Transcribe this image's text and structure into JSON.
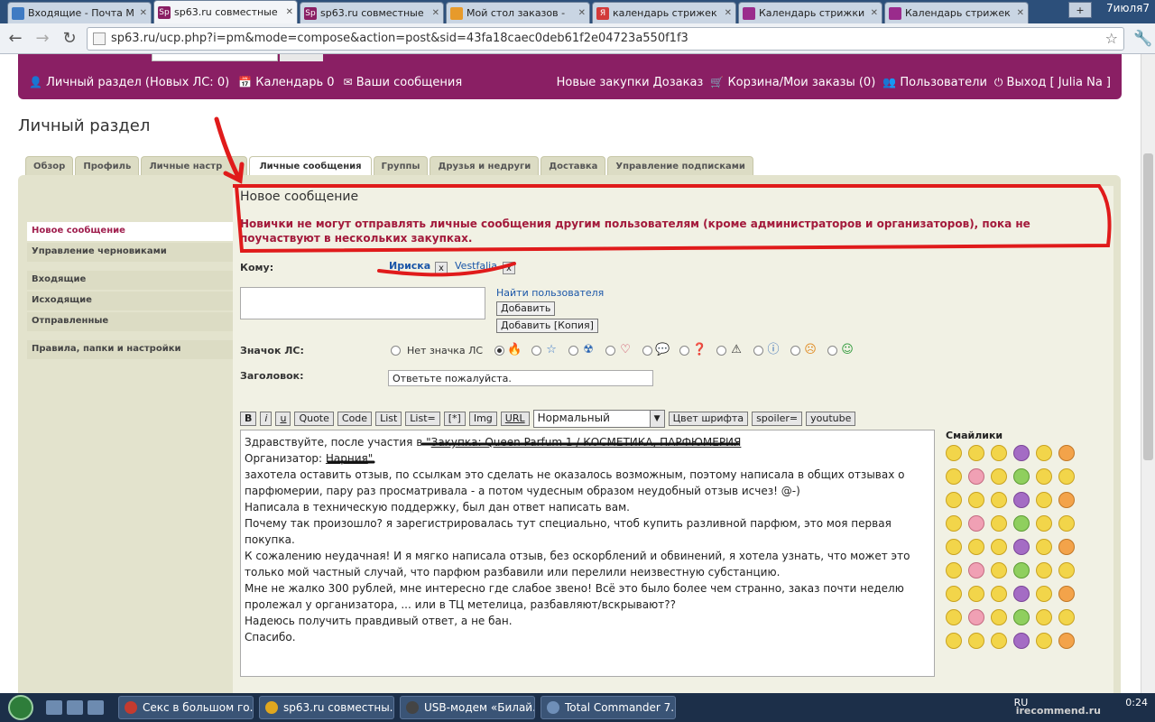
{
  "browser": {
    "tabs": [
      {
        "title": "Входящие - Почта M",
        "color": "#3f7bc3"
      },
      {
        "title": "sp63.ru совместные",
        "color": "#8a1f64"
      },
      {
        "title": "sp63.ru совместные",
        "color": "#8a1f64"
      },
      {
        "title": "Мой стол заказов - ",
        "color": "#e79a2b"
      },
      {
        "title": "календарь стрижек",
        "color": "#d23a3a"
      },
      {
        "title": "Календарь стрижки",
        "color": "#9a2b8c"
      },
      {
        "title": "Календарь стрижек",
        "color": "#9a2b8c"
      }
    ],
    "date_corner": "7июля7",
    "url": "sp63.ru/ucp.php?i=pm&mode=compose&action=post&sid=43fa18caec0deb61f2e04723a550f1f3"
  },
  "topbar": {
    "left": [
      {
        "icon": "person-icon",
        "label": "Личный раздел (Новых ЛС: 0)"
      },
      {
        "icon": "calendar-icon",
        "label": "Календарь 0"
      },
      {
        "icon": "envelope-icon",
        "label": "Ваши сообщения"
      }
    ],
    "right": [
      {
        "label": "Новые закупки"
      },
      {
        "label": "Дозаказ"
      },
      {
        "icon": "cart-icon",
        "label": "Корзина/Мои заказы (0)"
      },
      {
        "icon": "users-icon",
        "label": "Пользователи"
      },
      {
        "icon": "power-icon",
        "label": "Выход [ Julia Na ]"
      }
    ]
  },
  "page_title": "Личный раздел",
  "tabs": [
    "Обзор",
    "Профиль",
    "Личные настр",
    "Личные сообщения",
    "Группы",
    "Друзья и недруги",
    "Доставка",
    "Управление подписками"
  ],
  "sidenav": {
    "group1": [
      "Новое сообщение",
      "Управление черновиками"
    ],
    "group2": [
      "Входящие",
      "Исходящие",
      "Отправленные"
    ],
    "group3": [
      "Правила, папки и настройки"
    ]
  },
  "compose": {
    "heading": "Новое сообщение",
    "warning": "Новички не могут отправлять личные сообщения другим пользователям (кроме администраторов и организаторов), пока не поучаствуют в нескольких закупках.",
    "to_label": "Кому:",
    "recipients": [
      "Ириска",
      "Vestfalia"
    ],
    "remove_glyph": "x",
    "find_user": "Найти пользователя",
    "add_button": "Добавить",
    "add_copy_button": "Добавить [Копия]",
    "icon_label": "Значок ЛС:",
    "no_icon_label": "Нет значка ЛС",
    "icons": [
      "fire-icon",
      "star-icon",
      "radiation-icon",
      "heart-icon",
      "speech-bubble-icon",
      "question-icon",
      "warning-icon",
      "info-icon",
      "sad-face-icon",
      "grin-face-icon"
    ],
    "subject_label": "Заголовок:",
    "subject_value": "Ответьте пожалуйста.",
    "format_buttons": [
      "B",
      "i",
      "u",
      "Quote",
      "Code",
      "List",
      "List=",
      "[*]",
      "Img",
      "URL"
    ],
    "font_size_value": "Нормальный",
    "color_button": "Цвет шрифта",
    "spoiler_button": "spoiler=",
    "youtube_button": "youtube",
    "body": {
      "line1_prefix": "Здравствуйте, после участия в \"",
      "line1_link": "Закупка: Queen Parfum 1 / КОСМЕТИКА, ПАРФЮМЕРИЯ",
      "line2_prefix": "Организатор: ",
      "line2_link": "Нарния",
      "line2_suffix": "\"",
      "paragraph": "захотела оставить отзыв, по ссылкам это сделать не оказалось возможным, поэтому написала в общих отзывах о парфюмерии, пару раз просматривала - а потом чудесным образом неудобный отзыв исчез! @-)",
      "lines": [
        "Написала в техническую поддержку, был дан ответ написать вам.",
        "Почему так произошло? я зарегистрировалась тут специально, чтоб купить разливной парфюм, это моя первая покупка.",
        "К сожалению неудачная! И я мягко написала отзыв, без оскорблений и обвинений, я хотела узнать, что может это только мой частный случай, что парфюм разбавили или перелили неизвестную субстанцию.",
        "Мне не жалко 300 рублей, мне интересно где слабое звено! Всё это было более чем странно, заказ почти неделю пролежал у организатора, ... или в ТЦ метелица, разбавляют/вскрывают??",
        "Надеюсь получить правдивый ответ, а не бан.",
        "Спасибо."
      ]
    },
    "smilies_label": "Смайлики"
  },
  "taskbar": {
    "items": [
      {
        "label": "Секс в большом го...",
        "color": "#c43b2f"
      },
      {
        "label": "sp63.ru совместны...",
        "color": "#e0a71f"
      },
      {
        "label": "USB-модем «Билай...",
        "color": "#444"
      },
      {
        "label": "Total Commander 7...",
        "color": "#6f8fb8"
      }
    ],
    "lang": "RU",
    "time": "0:24",
    "watermark": "irecommend.ru"
  }
}
